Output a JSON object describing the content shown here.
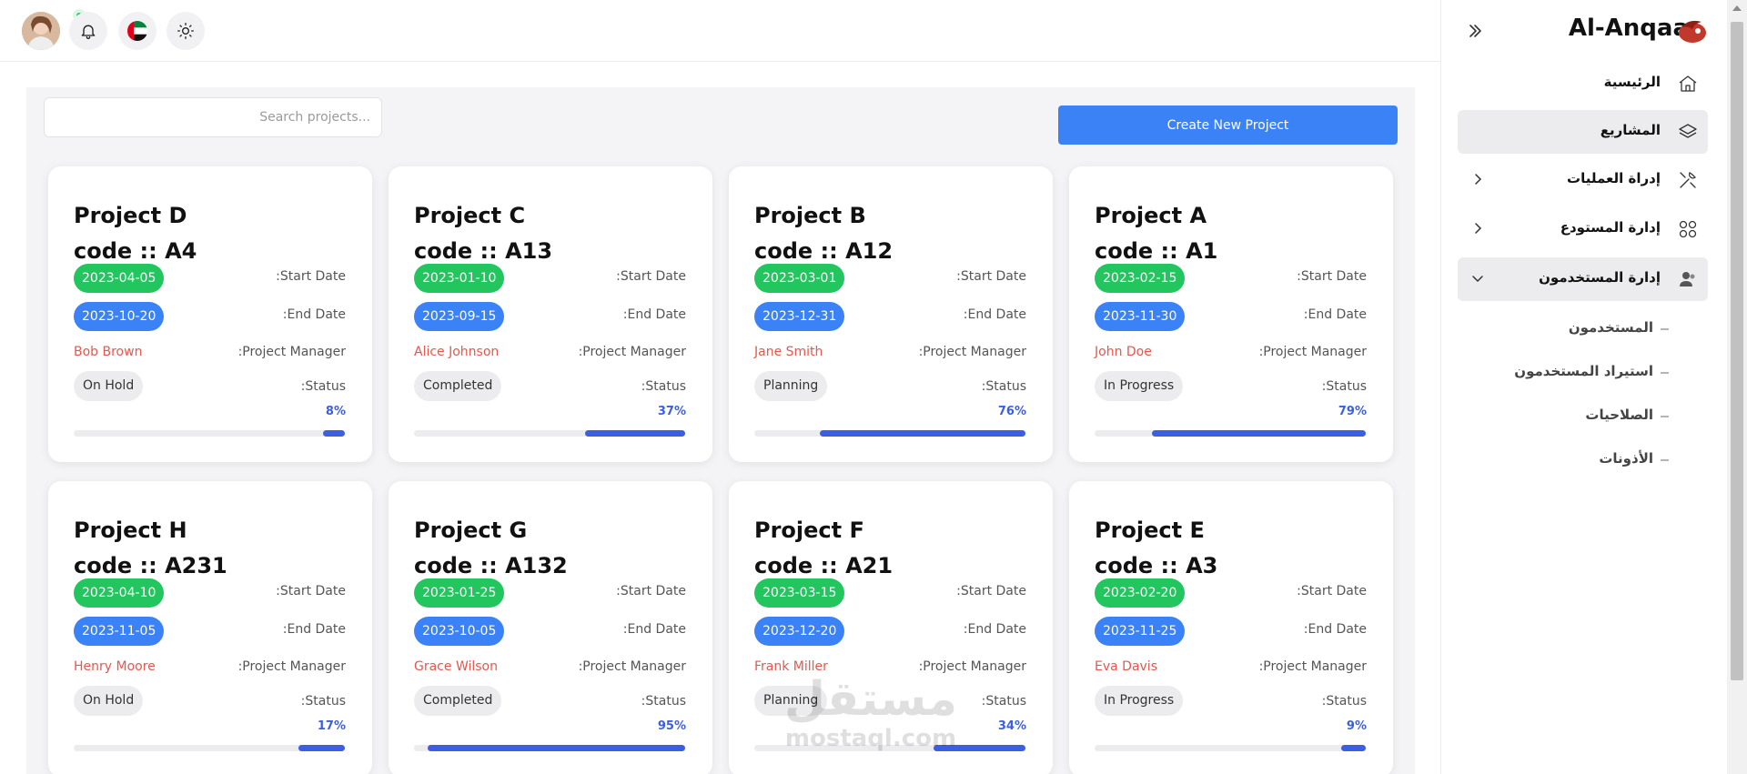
{
  "header": {
    "avatar_icon": "user-avatar",
    "notification_icon": "bell-icon",
    "language_icon": "uae-flag-icon",
    "theme_icon": "sun-icon"
  },
  "toolbar": {
    "search_placeholder": "...Search projects",
    "create_label": "Create New Project"
  },
  "labels": {
    "start_date": ":Start Date",
    "end_date": ":End Date",
    "project_manager": ":Project Manager",
    "status": ":Status"
  },
  "projects": [
    {
      "name": "Project D",
      "code": "code :: A4",
      "start": "2023-04-05",
      "end": "2023-10-20",
      "manager": "Bob Brown",
      "status": "On Hold",
      "progress": 8,
      "progress_label": "8%"
    },
    {
      "name": "Project C",
      "code": "code :: A13",
      "start": "2023-01-10",
      "end": "2023-09-15",
      "manager": "Alice Johnson",
      "status": "Completed",
      "progress": 37,
      "progress_label": "37%"
    },
    {
      "name": "Project B",
      "code": "code :: A12",
      "start": "2023-03-01",
      "end": "2023-12-31",
      "manager": "Jane Smith",
      "status": "Planning",
      "progress": 76,
      "progress_label": "76%"
    },
    {
      "name": "Project A",
      "code": "code :: A1",
      "start": "2023-02-15",
      "end": "2023-11-30",
      "manager": "John Doe",
      "status": "In Progress",
      "progress": 79,
      "progress_label": "79%"
    },
    {
      "name": "Project H",
      "code": "code :: A231",
      "start": "2023-04-10",
      "end": "2023-11-05",
      "manager": "Henry Moore",
      "status": "On Hold",
      "progress": 17,
      "progress_label": "17%"
    },
    {
      "name": "Project G",
      "code": "code :: A132",
      "start": "2023-01-25",
      "end": "2023-10-05",
      "manager": "Grace Wilson",
      "status": "Completed",
      "progress": 95,
      "progress_label": "95%"
    },
    {
      "name": "Project F",
      "code": "code :: A21",
      "start": "2023-03-15",
      "end": "2023-12-20",
      "manager": "Frank Miller",
      "status": "Planning",
      "progress": 34,
      "progress_label": "34%"
    },
    {
      "name": "Project E",
      "code": "code :: A3",
      "start": "2023-02-20",
      "end": "2023-11-25",
      "manager": "Eva Davis",
      "status": "In Progress",
      "progress": 9,
      "progress_label": "9%"
    }
  ],
  "sidebar": {
    "brand": "Al-Anqaa",
    "items": [
      {
        "label": "الرئيسية",
        "icon": "home-icon"
      },
      {
        "label": "المشاريع",
        "icon": "layers-icon"
      },
      {
        "label": "إدراة العمليات",
        "icon": "tools-icon"
      },
      {
        "label": "إدارة المستودع",
        "icon": "grid-icon"
      },
      {
        "label": "إدارة المستخدمون",
        "icon": "users-icon"
      }
    ],
    "sub_items": [
      {
        "label": "المستخدمون"
      },
      {
        "label": "استيراد المستخدمون"
      },
      {
        "label": "الصلاحيات"
      },
      {
        "label": "الأذونات"
      }
    ]
  },
  "watermark": {
    "arabic": "مستقل",
    "latin": "mostaql.com"
  },
  "colors": {
    "primary": "#3b82f6",
    "start_date": "#22c55e",
    "end_date": "#3b82f6",
    "manager": "#e5574d",
    "progress": "#3b5fe0"
  }
}
